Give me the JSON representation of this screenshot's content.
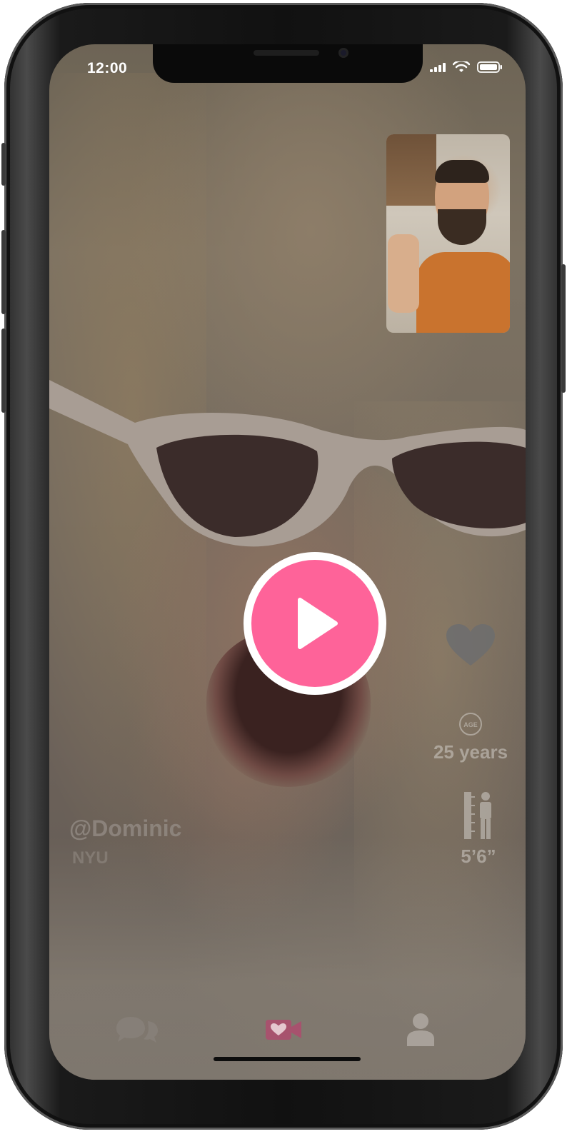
{
  "status_bar": {
    "time": "12:00",
    "icons": [
      "cellular-signal-icon",
      "wifi-icon",
      "battery-icon"
    ]
  },
  "video_call": {
    "state": "paused",
    "play_icon": "play-icon",
    "accent_color": "#fe6399"
  },
  "profile": {
    "username": "@Dominic",
    "school": "NYU",
    "age": "25 years",
    "age_icon": "age-icon",
    "height": "5’6”",
    "height_icon": "height-ruler-person-icon",
    "like_icon": "heart-icon"
  },
  "tab_bar": {
    "items": [
      {
        "icon": "chat-bubbles-icon",
        "active": false
      },
      {
        "icon": "video-heart-icon",
        "active": true
      },
      {
        "icon": "profile-person-icon",
        "active": false
      }
    ]
  }
}
